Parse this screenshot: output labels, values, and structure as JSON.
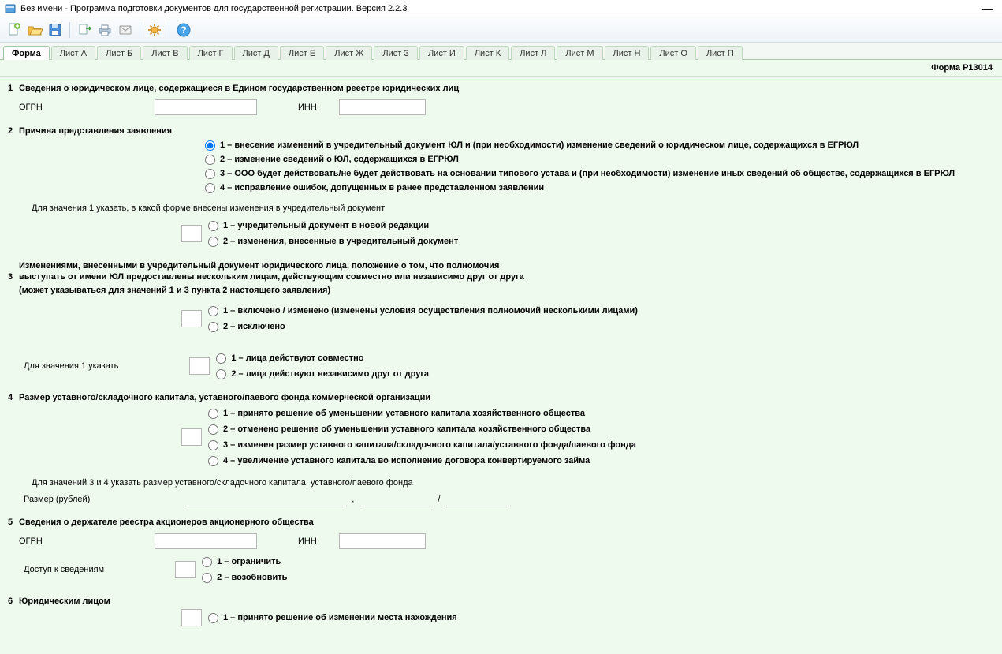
{
  "window": {
    "title": "Без имени - Программа подготовки документов для государственной регистрации. Версия 2.2.3"
  },
  "toolbar": {
    "new": "new-doc",
    "open": "open",
    "save": "save",
    "export": "export",
    "print": "print",
    "mail": "mail",
    "settings": "settings",
    "help": "help"
  },
  "tabs": [
    "Форма",
    "Лист А",
    "Лист Б",
    "Лист В",
    "Лист Г",
    "Лист Д",
    "Лист Е",
    "Лист Ж",
    "Лист З",
    "Лист И",
    "Лист К",
    "Лист Л",
    "Лист М",
    "Лист Н",
    "Лист О",
    "Лист П"
  ],
  "form_id": "Форма Р13014",
  "s1": {
    "num": "1",
    "title": "Сведения о юридическом лице, содержащиеся в Едином государственном реестре юридических лиц",
    "ogrn_label": "ОГРН",
    "inn_label": "ИНН"
  },
  "s2": {
    "num": "2",
    "title": "Причина представления заявления",
    "opts": [
      "1 – внесение изменений в учредительный документ ЮЛ и (при необходимости) изменение сведений о юридическом лице, содержащихся в ЕГРЮЛ",
      "2 – изменение сведений о ЮЛ, содержащихся в ЕГРЮЛ",
      "3 – ООО будет действовать/не будет действовать на основании типового устава и (при необходимости) изменение иных сведений об обществе, содержащихся в ЕГРЮЛ",
      "4 – исправление ошибок, допущенных в ранее представленном заявлении"
    ],
    "note1": "Для значения 1 указать, в какой форме внесены изменения в учредительный документ",
    "sub1": [
      "1 – учредительный документ в новой редакции",
      "2 – изменения, внесенные в учредительный документ"
    ]
  },
  "s3": {
    "num": "3",
    "lines": [
      "Изменениями, внесенными в учредительный документ юридического лица, положение о том, что полномочия",
      "выступать от имени ЮЛ предоставлены нескольким лицам, действующим совместно или независимо друг от друга",
      "(может указываться для значений 1 и 3 пункта 2 настоящего заявления)"
    ],
    "sub1": [
      "1 – включено / изменено (изменены условия осуществления полномочий несколькими лицами)",
      "2 – исключено"
    ],
    "note2": "Для значения 1 указать",
    "sub2": [
      "1 – лица действуют совместно",
      "2 – лица действуют независимо друг от друга"
    ]
  },
  "s4": {
    "num": "4",
    "title": "Размер уставного/складочного капитала, уставного/паевого фонда коммерческой организации",
    "opts": [
      "1 – принято решение об уменьшении уставного капитала хозяйственного общества",
      "2 – отменено решение об уменьшении уставного капитала хозяйственного общества",
      "3 – изменен размер уставного капитала/складочного капитала/уставного фонда/паевого фонда",
      "4 – увеличение уставного капитала во исполнение договора конвертируемого займа"
    ],
    "note": "Для значений 3 и 4 указать размер уставного/складочного капитала, уставного/паевого фонда",
    "amount_label": "Размер (рублей)",
    "sep1": ",",
    "sep2": "/"
  },
  "s5": {
    "num": "5",
    "title": "Сведения о держателе реестра акционеров акционерного общества",
    "ogrn_label": "ОГРН",
    "inn_label": "ИНН",
    "access_label": "Доступ к сведениям",
    "opts": [
      "1 – ограничить",
      "2 – возобновить"
    ]
  },
  "s6": {
    "num": "6",
    "title": "Юридическим лицом",
    "opts": [
      "1 – принято решение об изменении места нахождения"
    ]
  }
}
